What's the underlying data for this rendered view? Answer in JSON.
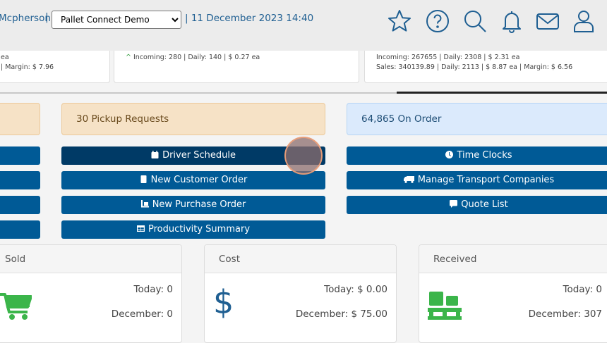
{
  "header": {
    "user_name": "Mcpherson",
    "separator": "|",
    "company_select": "Pallet Connect Demo",
    "datetime": "| 11 December 2023 14:40",
    "icons": [
      "star-icon",
      "help-icon",
      "search-icon",
      "bell-icon",
      "mail-icon",
      "user-icon"
    ]
  },
  "mini_cards": [
    {
      "line1": "ea",
      "line2": "| Margin: $ 7.96"
    },
    {
      "line1": "Incoming: 280 | Daily: 140 | $ 0.27 ea",
      "line2": ""
    },
    {
      "line1": "Incoming: 267655 | Daily: 2308 | $ 2.31 ea",
      "line2": "Sales: 340139.89 | Daily: 2113 | $ 8.87 ea | Margin: $ 6.56"
    }
  ],
  "info_boxes": {
    "pickup": "30 Pickup Requests",
    "on_order": "64,865 On Order"
  },
  "buttons": {
    "driver_schedule": "Driver Schedule",
    "new_customer_order": "New Customer Order",
    "new_purchase_order": "New Purchase Order",
    "productivity_summary": "Productivity Summary",
    "time_clocks": "Time Clocks",
    "manage_transport": "Manage Transport Companies",
    "quote_list": "Quote List"
  },
  "stats": {
    "sold": {
      "title": "Sold",
      "today": "Today: 0",
      "month": "December: 0",
      "icon": "cart-icon"
    },
    "cost": {
      "title": "Cost",
      "today": "Today: $ 0.00",
      "month": "December: $ 75.00",
      "icon": "dollar-icon"
    },
    "received": {
      "title": "Received",
      "today": "Today: 0",
      "month": "December: 307",
      "icon": "pallet-icon"
    }
  },
  "colors": {
    "primary": "#005a96",
    "primary_dark": "#003a66",
    "header_text": "#1f5f92",
    "orange_box": "#f6e2c6",
    "blue_box": "#dbeafc",
    "green_icon": "#3bb54a"
  }
}
